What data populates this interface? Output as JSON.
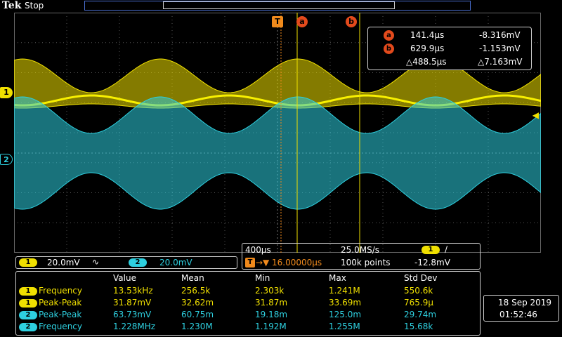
{
  "header": {
    "brand": "Tek",
    "acq_state": "Stop"
  },
  "markers": {
    "trigger_badge": "T",
    "cursor_a": "a",
    "cursor_b": "b",
    "ch1": "1",
    "ch2": "2"
  },
  "cursor_readout": {
    "a": {
      "label": "a",
      "time": "141.4µs",
      "value": "-8.316mV"
    },
    "b": {
      "label": "b",
      "time": "629.9µs",
      "value": "-1.153mV"
    },
    "delta": {
      "time": "△488.5µs",
      "value": "△7.163mV"
    }
  },
  "channel_scales": {
    "ch1": {
      "label": "1",
      "scale": "20.0mV",
      "coupling_icon": "∿"
    },
    "ch2": {
      "label": "2",
      "scale": "20.0mV"
    }
  },
  "timebase": {
    "time_per_div": "400µs",
    "sample_rate": "25.0MS/s",
    "trigger_badge": "T",
    "trigger_position": "16.00000µs",
    "record_length": "100k points",
    "trigger_source": "1",
    "trigger_slope": "∕",
    "trigger_level": "-12.8mV"
  },
  "measurements": {
    "headers": [
      "Value",
      "Mean",
      "Min",
      "Max",
      "Std Dev"
    ],
    "rows": [
      {
        "ch": "1",
        "name": "Frequency",
        "value": "13.53kHz",
        "mean": "256.5k",
        "min": "2.303k",
        "max": "1.241M",
        "std": "550.6k",
        "color": "#f0e000"
      },
      {
        "ch": "1",
        "name": "Peak-Peak",
        "value": "31.87mV",
        "mean": "32.62m",
        "min": "31.87m",
        "max": "33.69m",
        "std": "765.9µ",
        "color": "#f0e000"
      },
      {
        "ch": "2",
        "name": "Peak-Peak",
        "value": "63.73mV",
        "mean": "60.75m",
        "min": "19.18m",
        "max": "125.0m",
        "std": "29.74m",
        "color": "#2ed0e0"
      },
      {
        "ch": "2",
        "name": "Frequency",
        "value": "1.228MHz",
        "mean": "1.230M",
        "min": "1.192M",
        "max": "1.255M",
        "std": "15.68k",
        "color": "#2ed0e0"
      }
    ]
  },
  "datetime": {
    "date": "18 Sep  2019",
    "time": "01:52:46"
  },
  "colors": {
    "ch1": "#f0e000",
    "ch2": "#2ed0e0",
    "cursor": "#e34a1c",
    "trigger": "#f08a1c",
    "grid": "#555555"
  }
}
